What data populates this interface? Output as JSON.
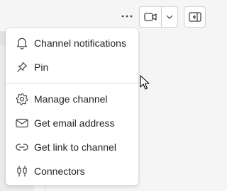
{
  "header": {
    "more_icon": "more-horizontal-icon",
    "video_icon": "video-camera-icon",
    "video_dropdown_icon": "chevron-down-icon",
    "panel_icon": "panel-collapse-icon"
  },
  "menu": {
    "items": [
      {
        "label": "Channel notifications",
        "icon": "bell-icon"
      },
      {
        "label": "Pin",
        "icon": "pin-icon"
      },
      {
        "label": "Manage channel",
        "icon": "gear-icon"
      },
      {
        "label": "Get email address",
        "icon": "mail-icon"
      },
      {
        "label": "Get link to channel",
        "icon": "link-icon"
      },
      {
        "label": "Connectors",
        "icon": "plug-icon"
      }
    ]
  },
  "colors": {
    "text": "#242424",
    "icon": "#424242",
    "menu_bg": "#ffffff",
    "page_bg": "#f5f5f5"
  }
}
